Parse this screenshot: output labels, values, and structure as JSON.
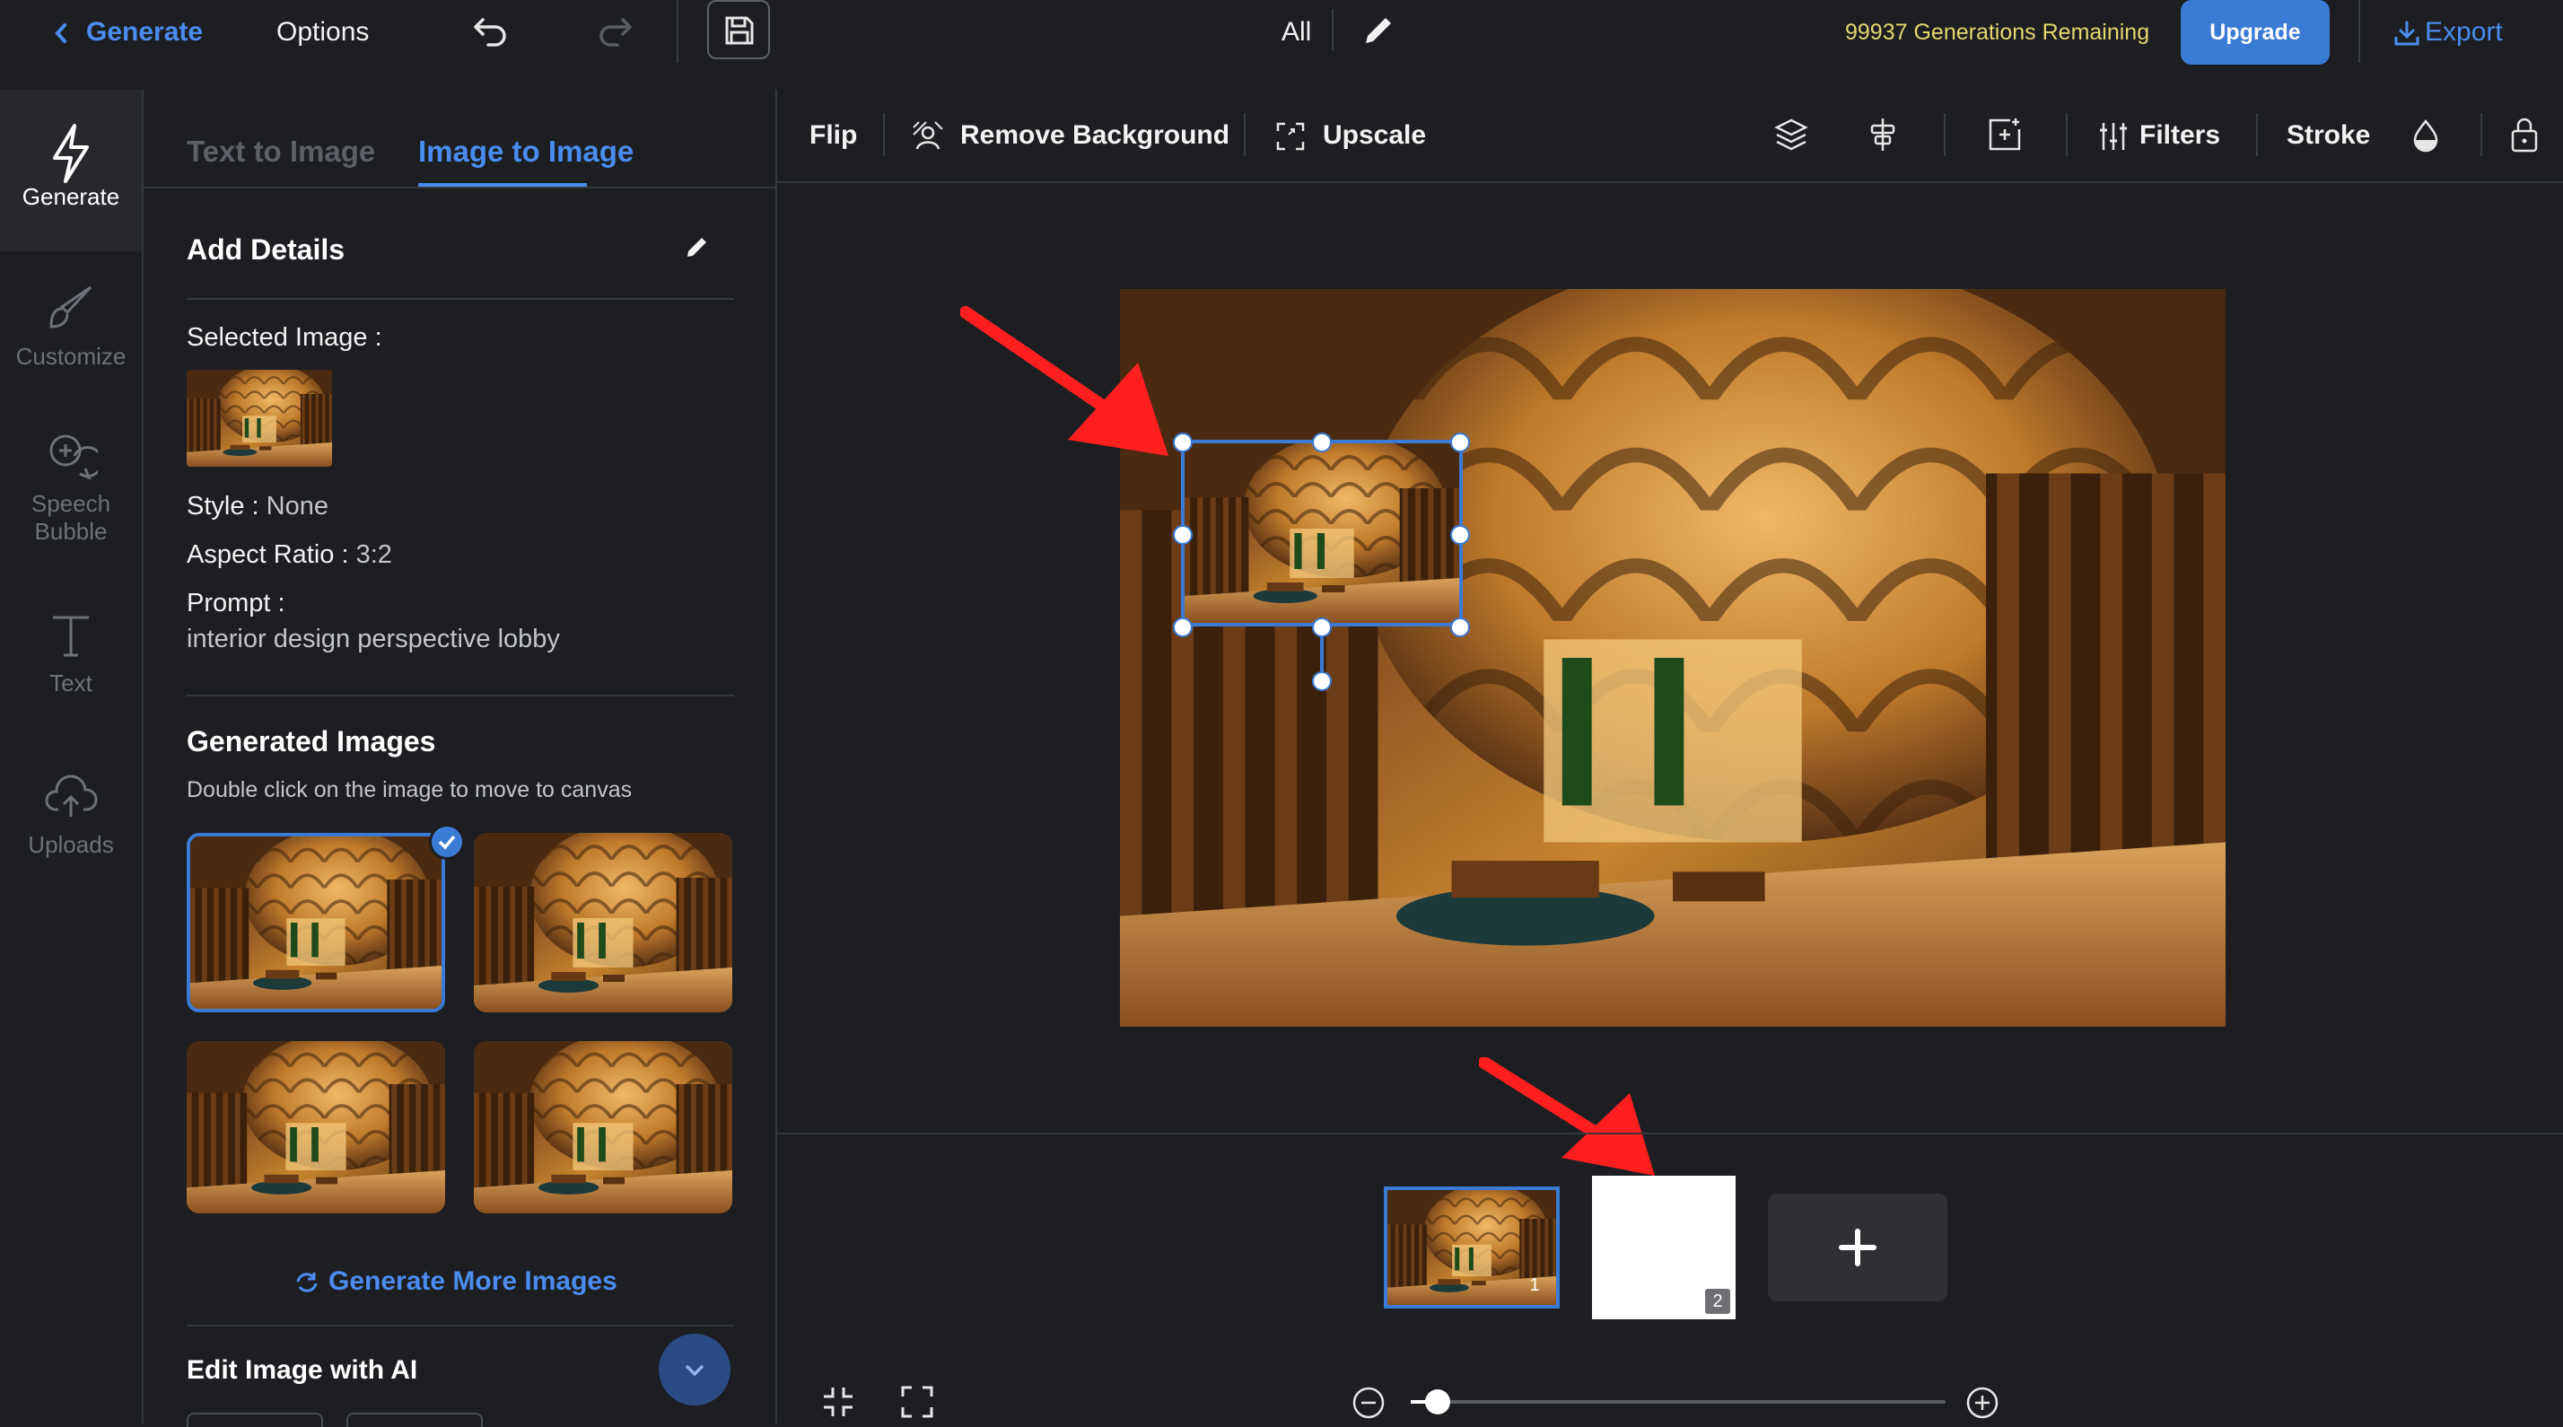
{
  "topbar": {
    "back_label": "Generate",
    "options_label": "Options",
    "layer_select": "All",
    "generations_remaining": "99937 Generations Remaining",
    "upgrade_label": "Upgrade",
    "export_label": "Export"
  },
  "rail": {
    "items": [
      {
        "label": "Generate",
        "icon": "lightning-icon"
      },
      {
        "label": "Customize",
        "icon": "brush-icon"
      },
      {
        "label": "Speech Bubble",
        "icon": "speech-bubble-icon"
      },
      {
        "label": "Text",
        "icon": "text-icon"
      },
      {
        "label": "Uploads",
        "icon": "cloud-upload-icon"
      }
    ]
  },
  "panel": {
    "tabs": [
      "Text to Image",
      "Image to Image"
    ],
    "active_tab": "Image to Image",
    "details_title": "Add Details",
    "selected_image_label": "Selected Image :",
    "style_key": "Style :",
    "style_value": "None",
    "aspect_key": "Aspect Ratio :",
    "aspect_value": "3:2",
    "prompt_key": "Prompt :",
    "prompt_value": "interior design perspective lobby",
    "generated_title": "Generated Images",
    "generated_hint": "Double click on the image to move to canvas",
    "generate_more_label": "Generate More Images",
    "edit_ai_title": "Edit Image with AI"
  },
  "toolbar": {
    "flip": "Flip",
    "remove_bg": "Remove Background",
    "upscale": "Upscale",
    "filters": "Filters",
    "stroke": "Stroke"
  },
  "pages": [
    {
      "number": "1",
      "selected": true
    },
    {
      "number": "2",
      "selected": false
    }
  ],
  "zoom": {
    "level": 0.05
  },
  "colors": {
    "accent": "#3a7bd5",
    "link_blue": "#4a8cf0",
    "remaining_yellow": "#e4d86e",
    "annotation_red": "#ff1f1f"
  }
}
